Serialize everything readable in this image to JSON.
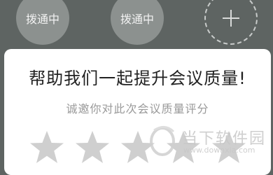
{
  "participants": [
    {
      "status": "拨通中"
    },
    {
      "status": "拨通中"
    }
  ],
  "add_button": {
    "icon": "plus-icon"
  },
  "dialog": {
    "title": "帮助我们一起提升会议质量!",
    "subtitle": "诚邀你对此次会议质量评分"
  },
  "rating": {
    "max": 5,
    "value": 0,
    "icon": "star-icon",
    "color_empty": "#cfcfcf"
  },
  "watermark": {
    "brand": "当下软件园",
    "site": "www.downxia.com"
  }
}
